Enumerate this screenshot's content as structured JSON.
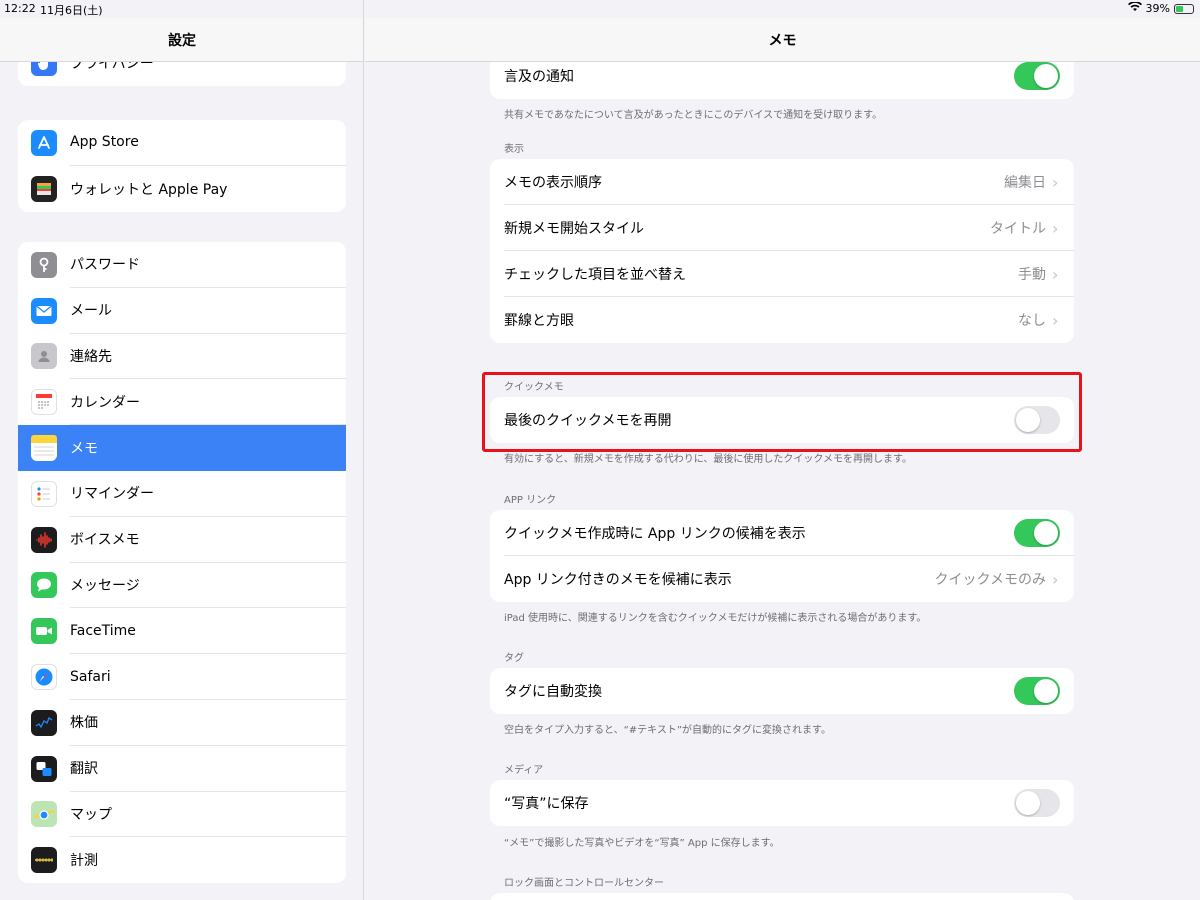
{
  "status": {
    "time": "12:22",
    "date": "11月6日(土)",
    "battery": "39%"
  },
  "sidebar": {
    "title": "設定",
    "group0": [
      {
        "label": "プライバシー",
        "icon": "hand-icon",
        "color": "#3478f6"
      }
    ],
    "group1": [
      {
        "label": "App Store",
        "icon": "app-store-icon",
        "color": "#1a8cff"
      },
      {
        "label": "ウォレットと Apple Pay",
        "icon": "wallet-icon",
        "color": "#222222"
      }
    ],
    "group2": [
      {
        "label": "パスワード",
        "icon": "key-icon",
        "color": "#8e8e93"
      },
      {
        "label": "メール",
        "icon": "mail-icon",
        "color": "#1a8cff"
      },
      {
        "label": "連絡先",
        "icon": "contacts-icon",
        "color": "#b8b8bd"
      },
      {
        "label": "カレンダー",
        "icon": "calendar-icon",
        "color": "#ffffff"
      },
      {
        "label": "メモ",
        "icon": "notes-icon",
        "color": "#ffd43b",
        "selected": true
      },
      {
        "label": "リマインダー",
        "icon": "reminders-icon",
        "color": "#ffffff"
      },
      {
        "label": "ボイスメモ",
        "icon": "voice-memo-icon",
        "color": "#1c1c1e"
      },
      {
        "label": "メッセージ",
        "icon": "messages-icon",
        "color": "#34c759"
      },
      {
        "label": "FaceTime",
        "icon": "facetime-icon",
        "color": "#34c759"
      },
      {
        "label": "Safari",
        "icon": "safari-icon",
        "color": "#ffffff"
      },
      {
        "label": "株価",
        "icon": "stocks-icon",
        "color": "#1c1c1e"
      },
      {
        "label": "翻訳",
        "icon": "translate-icon",
        "color": "#1c1c1e"
      },
      {
        "label": "マップ",
        "icon": "maps-icon",
        "color": "#7bd389"
      },
      {
        "label": "計測",
        "icon": "measure-icon",
        "color": "#1c1c1e"
      }
    ]
  },
  "main": {
    "title": "メモ",
    "mention": {
      "label": "言及の通知",
      "on": true,
      "caption": "共有メモであなたについて言及があったときにこのデバイスで通知を受け取ります。"
    },
    "display": {
      "section": "表示",
      "rows": [
        {
          "label": "メモの表示順序",
          "value": "編集日"
        },
        {
          "label": "新規メモ開始スタイル",
          "value": "タイトル"
        },
        {
          "label": "チェックした項目を並べ替え",
          "value": "手動"
        },
        {
          "label": "罫線と方眼",
          "value": "なし"
        }
      ]
    },
    "quick": {
      "section": "クイックメモ",
      "label": "最後のクイックメモを再開",
      "on": false,
      "caption": "有効にすると、新規メモを作成する代わりに、最後に使用したクイックメモを再開します。"
    },
    "applink": {
      "section": "APP リンク",
      "row1": {
        "label": "クイックメモ作成時に App リンクの候補を表示",
        "on": true
      },
      "row2": {
        "label": "App リンク付きのメモを候補に表示",
        "value": "クイックメモのみ"
      },
      "caption": "iPad 使用時に、関連するリンクを含むクイックメモだけが候補に表示される場合があります。"
    },
    "tags": {
      "section": "タグ",
      "label": "タグに自動変換",
      "on": true,
      "caption": "空白をタイプ入力すると、“#テキスト”が自動的にタグに変換されます。"
    },
    "media": {
      "section": "メディア",
      "label": "“写真”に保存",
      "on": false,
      "caption": "“メモ”で撮影した写真やビデオを“写真” App に保存します。"
    },
    "lock": {
      "section": "ロック画面とコントロールセンター"
    },
    "chevron": "›"
  },
  "colors": {
    "toggle_on": "#34c759",
    "selection": "#3b82f6",
    "highlight": "#e8121b"
  }
}
